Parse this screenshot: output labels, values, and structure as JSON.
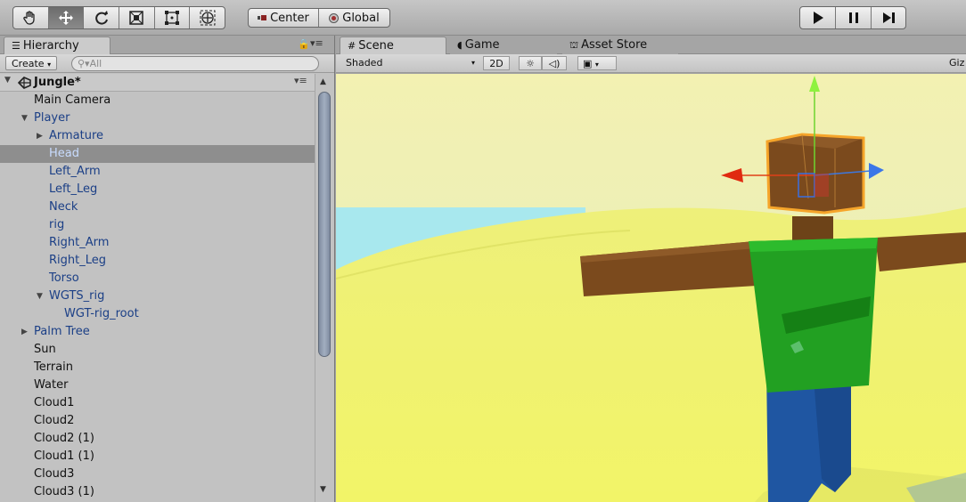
{
  "toolbar": {
    "tools": [
      "hand-icon",
      "move-icon",
      "rotate-icon",
      "scale-icon",
      "rect-icon",
      "transform-icon"
    ],
    "pivot_label": "Center",
    "space_label": "Global",
    "play_icons": [
      "play-icon",
      "pause-icon",
      "step-icon"
    ]
  },
  "hierarchy": {
    "tab_label": "Hierarchy",
    "create_label": "Create",
    "search_placeholder": "All",
    "scene_name": "Jungle*",
    "items": [
      {
        "label": "Main Camera",
        "depth": 0,
        "arrow": "",
        "color": "normal"
      },
      {
        "label": "Player",
        "depth": 0,
        "arrow": "open",
        "color": "blue"
      },
      {
        "label": "Armature",
        "depth": 1,
        "arrow": "closed",
        "color": "blue"
      },
      {
        "label": "Head",
        "depth": 1,
        "arrow": "",
        "color": "blue",
        "selected": true
      },
      {
        "label": "Left_Arm",
        "depth": 1,
        "arrow": "",
        "color": "blue"
      },
      {
        "label": "Left_Leg",
        "depth": 1,
        "arrow": "",
        "color": "blue"
      },
      {
        "label": "Neck",
        "depth": 1,
        "arrow": "",
        "color": "blue"
      },
      {
        "label": "rig",
        "depth": 1,
        "arrow": "",
        "color": "blue"
      },
      {
        "label": "Right_Arm",
        "depth": 1,
        "arrow": "",
        "color": "blue"
      },
      {
        "label": "Right_Leg",
        "depth": 1,
        "arrow": "",
        "color": "blue"
      },
      {
        "label": "Torso",
        "depth": 1,
        "arrow": "",
        "color": "blue"
      },
      {
        "label": "WGTS_rig",
        "depth": 1,
        "arrow": "open",
        "color": "blue"
      },
      {
        "label": "WGT-rig_root",
        "depth": 2,
        "arrow": "",
        "color": "blue"
      },
      {
        "label": "Palm Tree",
        "depth": 0,
        "arrow": "closed",
        "color": "blue"
      },
      {
        "label": "Sun",
        "depth": 0,
        "arrow": "",
        "color": "normal"
      },
      {
        "label": "Terrain",
        "depth": 0,
        "arrow": "",
        "color": "normal"
      },
      {
        "label": "Water",
        "depth": 0,
        "arrow": "",
        "color": "normal"
      },
      {
        "label": "Cloud1",
        "depth": 0,
        "arrow": "",
        "color": "normal"
      },
      {
        "label": "Cloud2",
        "depth": 0,
        "arrow": "",
        "color": "normal"
      },
      {
        "label": "Cloud2 (1)",
        "depth": 0,
        "arrow": "",
        "color": "normal"
      },
      {
        "label": "Cloud1 (1)",
        "depth": 0,
        "arrow": "",
        "color": "normal"
      },
      {
        "label": "Cloud3",
        "depth": 0,
        "arrow": "",
        "color": "normal"
      },
      {
        "label": "Cloud3 (1)",
        "depth": 0,
        "arrow": "",
        "color": "normal"
      }
    ]
  },
  "scene": {
    "tabs": [
      {
        "label": "Scene",
        "icon": "grid-icon",
        "active": true
      },
      {
        "label": "Game",
        "icon": "pacman-icon",
        "active": false
      },
      {
        "label": "Asset Store",
        "icon": "store-icon",
        "active": false
      }
    ],
    "shading_mode": "Shaded",
    "mode_2d_label": "2D",
    "gizmos_label": "Giz"
  },
  "colors": {
    "accent_blue": "#1b3f86",
    "selection": "#8e8e8e",
    "skin": "#7a4a1c",
    "shirt": "#22a022",
    "pants": "#1f56a2",
    "ground": "#eef277"
  }
}
